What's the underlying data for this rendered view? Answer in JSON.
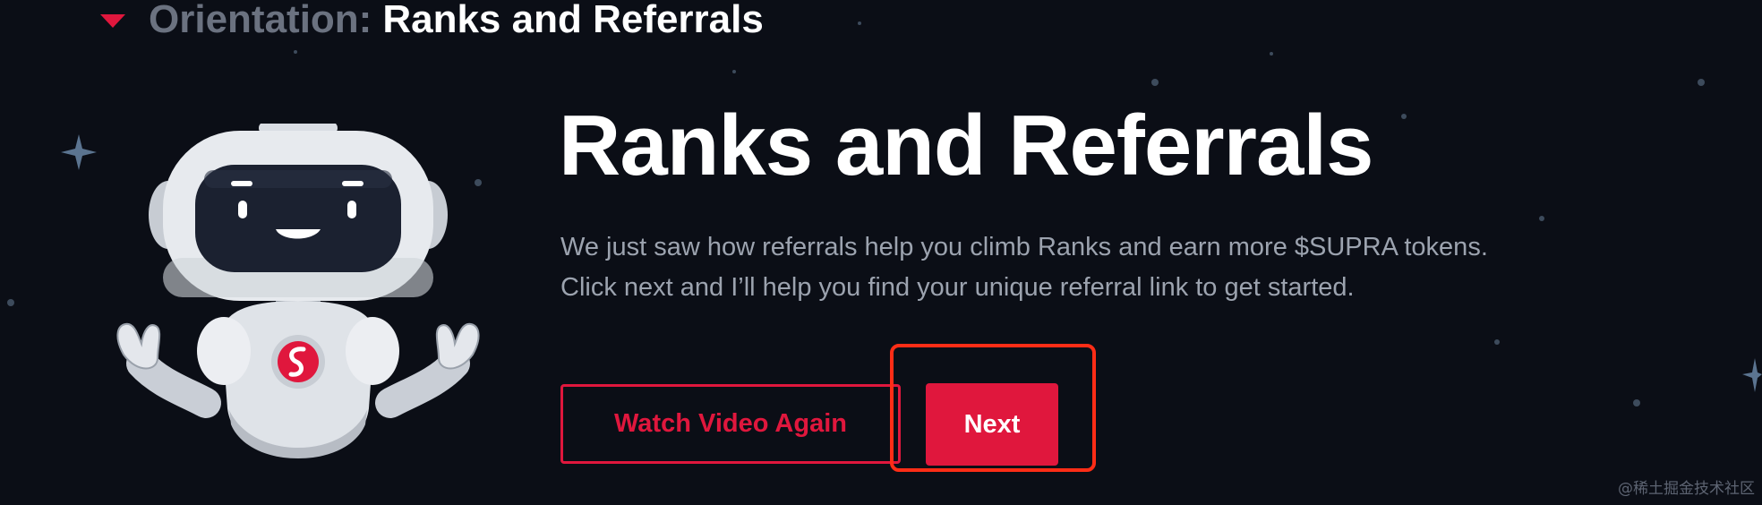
{
  "header": {
    "prefix": "Orientation:",
    "title": "Ranks and Referrals"
  },
  "main": {
    "title": "Ranks and Referrals",
    "description": "We just saw how referrals help you climb Ranks and earn more $SUPRA tokens. Click next and I’ll help you find your unique referral link to get started."
  },
  "actions": {
    "watch_video_label": "Watch Video Again",
    "next_label": "Next"
  },
  "watermark": "@稀土掘金技术社区",
  "colors": {
    "background": "#0b0e16",
    "accent": "#e0173d",
    "highlight_outline": "#ff2d16",
    "text_muted": "#9ca3af"
  },
  "icons": {
    "caret": "caret-down-icon",
    "mascot": "robot-mascot"
  }
}
